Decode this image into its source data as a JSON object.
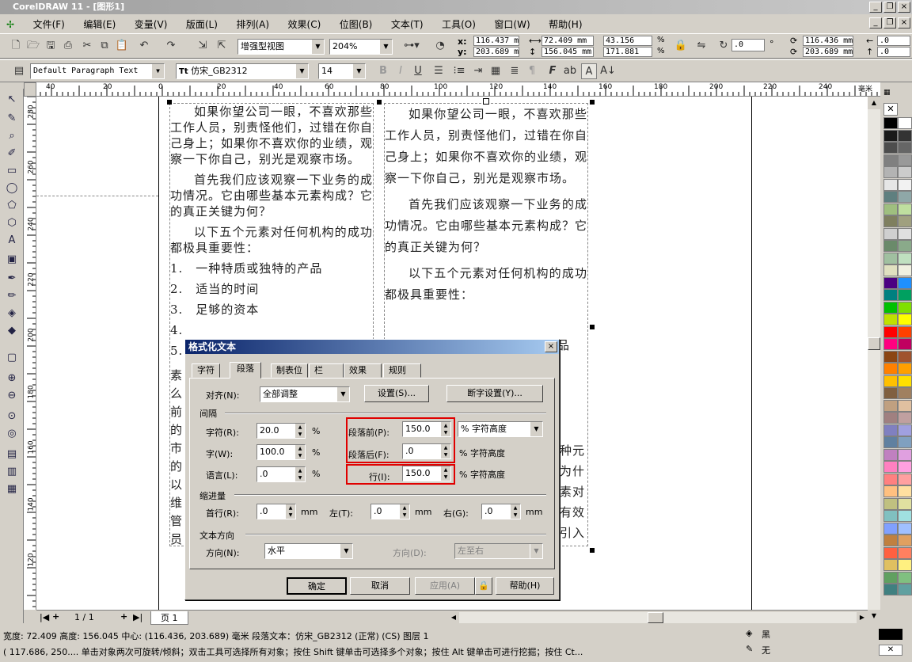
{
  "window_title": "CorelDRAW 11 - [图形1]",
  "menu": [
    "文件(F)",
    "编辑(E)",
    "变量(V)",
    "版面(L)",
    "排列(A)",
    "效果(C)",
    "位图(B)",
    "文本(T)",
    "工具(O)",
    "窗口(W)",
    "帮助(H)"
  ],
  "toolbar": {
    "view_mode": "增强型视图",
    "zoom": "204%",
    "x": "116.437 m",
    "y": "203.689 m",
    "width": "72.409 mm",
    "height": "156.045 mm",
    "scale_x": "43.156",
    "scale_y": "171.881",
    "pct": "%",
    "angle": ".0",
    "deg": "°",
    "pos_x2": "116.436 mm",
    "pos_y2": "203.689 mm",
    "nudge1": ".0",
    "nudge2": ".0"
  },
  "text_toolbar": {
    "style": "Default Paragraph Text",
    "font": "仿宋_GB2312",
    "size": "14"
  },
  "ruler_h": [
    "40",
    "20",
    "0",
    "20",
    "40",
    "60",
    "80",
    "100",
    "120",
    "140",
    "160",
    "180",
    "200",
    "220",
    "240",
    "毫米"
  ],
  "ruler_v": [
    "280",
    "260",
    "240",
    "220",
    "200",
    "180",
    "160",
    "140",
    "120"
  ],
  "left_column": {
    "p1": "如果你望公司一眼，不喜欢那些工作人员，别责怪他们，过错在你自己身上；如果你不喜欢你的业绩，观察一下你自己，别光是观察市场。",
    "p2": "首先我们应该观察一下业务的成功情况。它由哪些基本元素构成？它的真正关键为何？",
    "p3": "以下五个元素对任何机构的成功都极具重要性：",
    "l1": "1.　一种特质或独特的产品",
    "l2": "2.　适当的时间",
    "l3": "3.　足够的资本",
    "l4": "4.",
    "l5": "5.",
    "tail": "素\n么\n前\n的\n市\n的\n以\n维\n管\n员"
  },
  "right_column": {
    "p1": "如果你望公司一眼，不喜欢那些工作人员，别责怪他们，过错在你自己身上；如果你不喜欢你的业绩，观察一下你自己，别光是观察市场。",
    "p2": "首先我们应该观察一下业务的成功情况。它由哪些基本元素构成？它的真正关键为何？",
    "p3": "以下五个元素对任何机构的成功都极具重要性：",
    "frag": "品",
    "tail": "种元\n为什\n素对\n有效\n引入"
  },
  "dialog": {
    "title": "格式化文本",
    "tabs": [
      "字符",
      "段落",
      "制表位",
      "栏",
      "效果",
      "规则"
    ],
    "align_label": "对齐(N):",
    "align_value": "全部调整",
    "settings_btn": "设置(S)...",
    "hyphen_btn": "断字设置(Y)...",
    "spacing_group": "间隔",
    "char_label": "字符(R):",
    "char_value": "20.0",
    "word_label": "字(W):",
    "word_value": "100.0",
    "lang_label": "语言(L):",
    "lang_value": ".0",
    "pct": "%",
    "before_label": "段落前(P):",
    "before_value": "150.0",
    "after_label": "段落后(F):",
    "after_value": ".0",
    "line_label": "行(I):",
    "line_value": "150.0",
    "unit_combo": "% 字符高度",
    "unit_text": "% 字符高度",
    "indent_group": "缩进量",
    "first_label": "首行(R):",
    "first_value": ".0",
    "left_label": "左(T):",
    "left_value": ".0",
    "right_label": "右(G):",
    "right_value": ".0",
    "mm": "mm",
    "dir_group": "文本方向",
    "orient_label": "方向(N):",
    "orient_value": "水平",
    "dir_label": "方向(D):",
    "dir_value": "左至右",
    "ok": "确定",
    "cancel": "取消",
    "apply": "应用(A)",
    "help": "帮助(H)"
  },
  "page_nav": {
    "counter": "1 / 1",
    "tab": "页 1"
  },
  "status": {
    "line1": "宽度: 72.409 高度: 156.045 中心: (116.436, 203.689) 毫米    段落文本：仿宋_GB2312 (正常) (CS) 图层 1",
    "line2": "( 117.686, 250.... 单击对象两次可旋转/倾斜；双击工具可选择所有对象；按住 Shift 键单击可选择多个对象；按住 Alt 键单击可进行挖掘；按住 Ct...",
    "fill": "黑",
    "outline": "无"
  },
  "colors": {
    "accent_title": "#0a246a",
    "highlight": "#e00000"
  }
}
